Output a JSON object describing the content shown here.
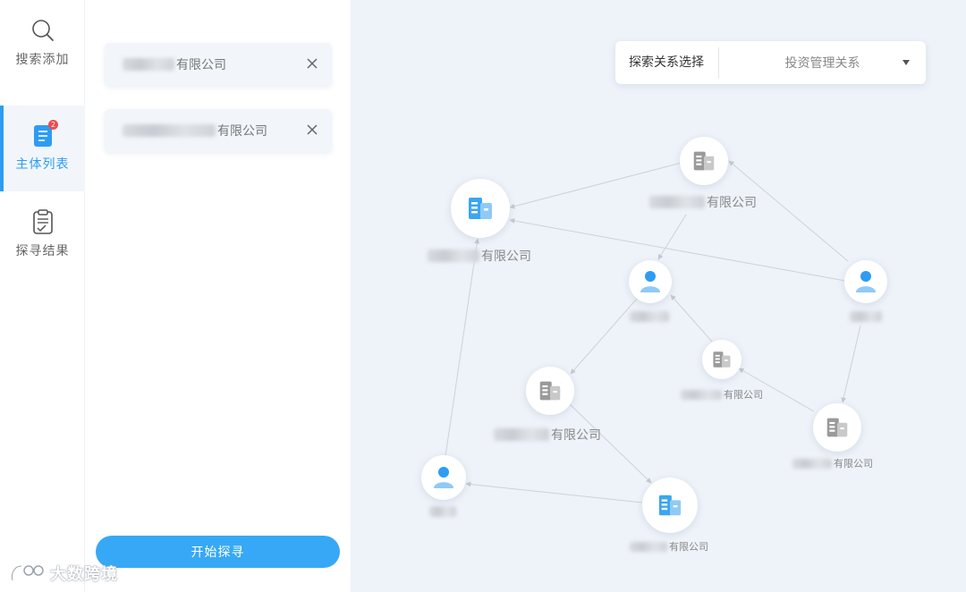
{
  "sidebar": {
    "items": [
      {
        "label": "搜索添加",
        "icon": "search-icon"
      },
      {
        "label": "主体列表",
        "icon": "document-list-icon",
        "badge": "2",
        "active": true
      },
      {
        "label": "探寻结果",
        "icon": "clipboard-check-icon"
      }
    ]
  },
  "entity_list": {
    "items": [
      {
        "name": "有限公司"
      },
      {
        "name": "有限公司"
      }
    ],
    "start_button": "开始探寻"
  },
  "graph": {
    "selector": {
      "label": "探索关系选择",
      "value": "投资管理关系"
    },
    "nodes": [
      {
        "id": "n1",
        "type": "company",
        "highlight": true,
        "label": "有限公司"
      },
      {
        "id": "n2",
        "type": "company",
        "highlight": false,
        "label": "有限公司"
      },
      {
        "id": "n3",
        "type": "person",
        "label": ""
      },
      {
        "id": "n4",
        "type": "person",
        "label": ""
      },
      {
        "id": "n5",
        "type": "company",
        "highlight": false,
        "label": "有限公司"
      },
      {
        "id": "n6",
        "type": "company",
        "highlight": false,
        "label": "有限公司"
      },
      {
        "id": "n7",
        "type": "company",
        "highlight": false,
        "label": "有限公司"
      },
      {
        "id": "n8",
        "type": "person",
        "label": ""
      },
      {
        "id": "n9",
        "type": "company",
        "highlight": true,
        "label": "有限公司"
      }
    ]
  },
  "watermark": "大数跨境",
  "colors": {
    "accent": "#2e9cf3",
    "button": "#37a8f5",
    "badge": "#f24b4b",
    "company_highlight": "#3aa6f2",
    "company_gray": "#9a9a9a"
  }
}
